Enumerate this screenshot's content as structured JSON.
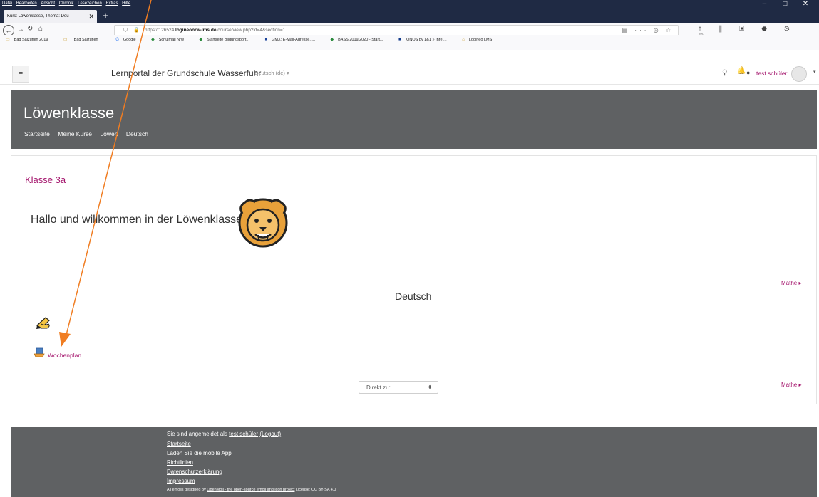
{
  "browser": {
    "menu": [
      "Datei",
      "Bearbeiten",
      "Ansicht",
      "Chronik",
      "Lesezeichen",
      "Extras",
      "Hilfe"
    ],
    "window_controls": [
      "–",
      "□",
      "✕"
    ],
    "tab_title": "Kurs: Löwenklasse, Thema: Deu",
    "tab_close": "✕",
    "new_tab": "+",
    "url_prefix": "https://126524.",
    "url_domain": "logineonrw-lms.de",
    "url_path": "/course/view.php?id=4&section=1",
    "url_actions": "▤ ··· ◎ ☆",
    "toolbar_icons": "⤒ ⫼ ▣ ⬣ ⚙ ♡ ≡",
    "bookmarks": [
      "Bad Salzuflen 2019",
      "_Bad Salzuflen_",
      "Google",
      "Schulmail Nrw",
      "Startseite Bildungsport...",
      "GMX: E-Mail-Adresse, ...",
      "BASS 2019/2020 - Start...",
      "IONOS by 1&1 » Ihre ...",
      "Logineo LMS"
    ]
  },
  "header": {
    "menu_icon": "≡",
    "site_name": "Lernportal der Grundschule Wasserfuhr",
    "language": "Deutsch (de) ▾",
    "user_name": "test schüler",
    "caret": "▾"
  },
  "course": {
    "title": "Löwenklasse",
    "breadcrumb": [
      "Startseite",
      "Meine Kurse",
      "Löwen",
      "Deutsch"
    ]
  },
  "content": {
    "section_title": "Klasse 3a",
    "welcome": "Hallo und willkommen in der Löwenklasse",
    "next_link": "Mathe ▸",
    "topic_title": "Deutsch",
    "activity_label": "Wochenplan",
    "jump_label": "Direkt zu:",
    "jump_arrow": "⬍"
  },
  "footer": {
    "logged_in_prefix": "Sie sind angemeldet als ",
    "logged_in_user": "test schüler",
    "logout": "(Logout)",
    "links": [
      "Startseite",
      "Laden Sie die mobile App",
      "Richtlinien",
      "Datenschutzerklärung",
      "Impressum"
    ],
    "emoji_prefix": "All emojis designed by ",
    "emoji_link": "OpenMoji - the open-source emoji and icon project",
    "emoji_license": " License: CC BY-SA 4.0"
  },
  "colors": {
    "accent": "#a4146c",
    "banner": "#5f6163",
    "browser_chrome": "#1f2a44",
    "arrow": "#f07d22"
  }
}
